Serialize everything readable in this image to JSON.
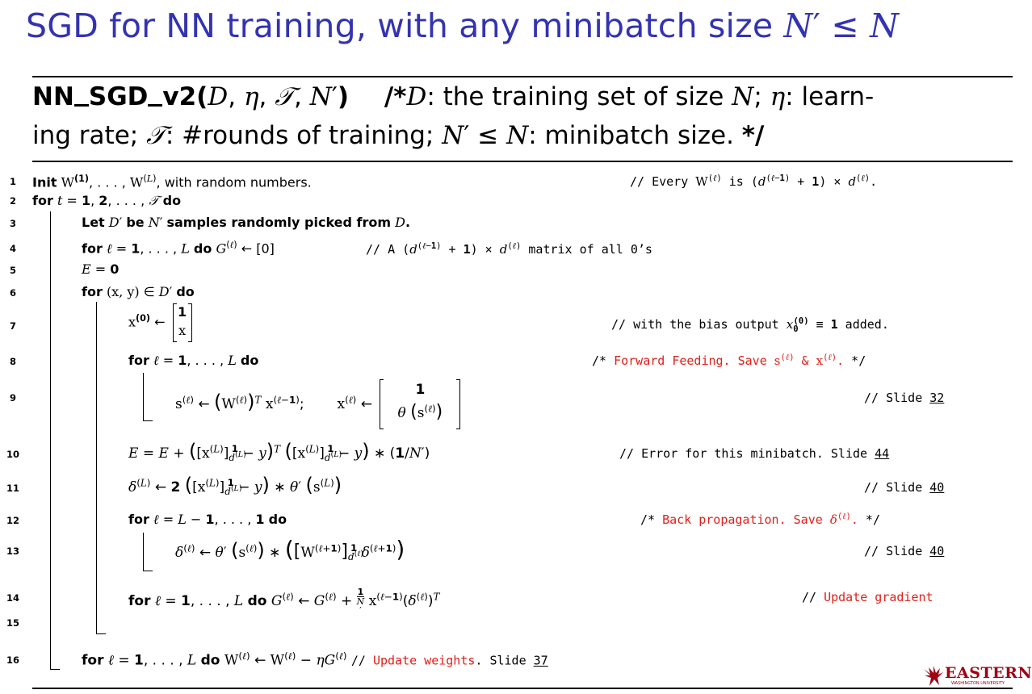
{
  "slide_title": "SGD for NN training, with any minibatch size N′ ≤ N",
  "header": {
    "proc_name": "NN_SGD_v2",
    "proc_args": "(D, η, 𝒯, N′)",
    "comment_line1": "/*D: the training set of size N; η: learn-",
    "comment_line2": "ing rate; 𝒯: #rounds of training; N′ ≤ N: minibatch size. */"
  },
  "lines": [
    {
      "n": "1",
      "code": "Init W(1), . . . , W(L), with random numbers.",
      "comment": "// Every W(ℓ) is (d(ℓ−1) + 1) × d(ℓ)."
    },
    {
      "n": "2",
      "code": "for t = 1, 2, . . . , 𝒯 do",
      "comment": ""
    },
    {
      "n": "3",
      "code": "Let D′ be N′ samples randomly picked from D.",
      "comment": ""
    },
    {
      "n": "4",
      "code": "for ℓ = 1, . . . , L do G(ℓ) ← [0]",
      "comment": "// A (d(ℓ−1) + 1) × d(ℓ) matrix of all 0's"
    },
    {
      "n": "5",
      "code": "E = 0",
      "comment": ""
    },
    {
      "n": "6",
      "code": "for (x, y) ∈ D′ do",
      "comment": ""
    },
    {
      "n": "7",
      "code": "x(0) ← [1; x]",
      "comment": "// with the bias output x0(0) ≡ 1 added."
    },
    {
      "n": "8",
      "code": "for ℓ = 1, . . . , L do",
      "comment": "/* Forward Feeding.  Save s(ℓ) & x(ℓ).  */"
    },
    {
      "n": "9",
      "code": "s(ℓ) ← (W(ℓ))T x(ℓ−1);    x(ℓ) ← [1; θ(s(ℓ))]",
      "comment": "// Slide 32"
    },
    {
      "n": "10",
      "code": "E = E + ([x(L)]1d(L) − y)T ([x(L)]1d(L) − y) ∗ (1/N′)",
      "comment": "// Error for this minibatch.  Slide 44"
    },
    {
      "n": "11",
      "code": "δ(L) ← 2 ([x(L)]1d(L) − y) ∗ θ′ (s(L))",
      "comment": "// Slide 40"
    },
    {
      "n": "12",
      "code": "for ℓ = L − 1, . . . , 1 do",
      "comment": "/* Back propagation.  Save δ(ℓ).  */"
    },
    {
      "n": "13",
      "code": "δ(ℓ) ← θ′ (s(ℓ)) ∗ ([W(ℓ+1)]1d(ℓ) δ(ℓ+1))",
      "comment": "// Slide 40"
    },
    {
      "n": "14",
      "code": "for ℓ = 1, . . . , L do  G(ℓ) ← G(ℓ) + 1/N′ x(ℓ−1)(δ(ℓ))T",
      "comment": "// Update gradient"
    },
    {
      "n": "15",
      "code": "",
      "comment": ""
    },
    {
      "n": "16",
      "code": "for ℓ = 1, . . . , L do  W(ℓ) ← W(ℓ) − ηG(ℓ)",
      "comment": "// Update weights.  Slide 37"
    }
  ],
  "logo": {
    "name": "EASTERN",
    "subtitle": "WASHINGTON UNIVERSITY"
  },
  "colors": {
    "title": "#3333b2",
    "highlight": "#e0201a",
    "logo": "#a00014"
  }
}
